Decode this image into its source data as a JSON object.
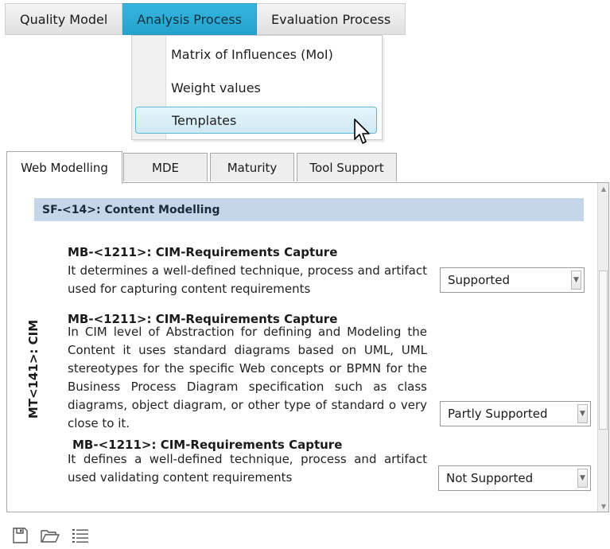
{
  "menu": {
    "items": [
      {
        "label": "Quality Model"
      },
      {
        "label": "Analysis Process"
      },
      {
        "label": "Evaluation Process"
      }
    ],
    "active_index": 1,
    "dropdown": [
      {
        "label": "Matrix of Influences (MoI)"
      },
      {
        "label": "Weight values"
      },
      {
        "label": "Templates"
      }
    ],
    "hover_index": 2
  },
  "tabs": [
    {
      "label": "Web Modelling"
    },
    {
      "label": "MDE"
    },
    {
      "label": "Maturity"
    },
    {
      "label": "Tool Support"
    }
  ],
  "active_tab": 0,
  "section": {
    "title": "SF-<14>: Content Modelling",
    "side_label": "MT<141>: CIM",
    "entries": [
      {
        "title": "MB-<1211>: CIM-Requirements Capture",
        "description": "It determines a well-defined technique, process and artifact used for capturing content requirements",
        "support": "Supported"
      },
      {
        "title": "MB-<1211>: CIM-Requirements Capture",
        "description": "In CIM level of Abstraction for defining and Modeling the Content it uses standard diagrams based on UML, UML stereotypes for the specific Web concepts or BPMN for the Business Process Diagram specification such as class diagrams, object diagram, or other type of standard o very close to it.",
        "support": "Partly Supported"
      },
      {
        "title": "MB-<1211>: CIM-Requirements Capture",
        "description": "It defines a well-defined technique, process and artifact used validating content requirements",
        "support": "Not Supported"
      }
    ]
  },
  "colors": {
    "menu_active": "#2aa8d2",
    "section_header": "#c5d6ea",
    "hover_border": "#5bb8d8"
  },
  "icons": [
    "save-icon",
    "open-folder-icon",
    "list-icon"
  ]
}
